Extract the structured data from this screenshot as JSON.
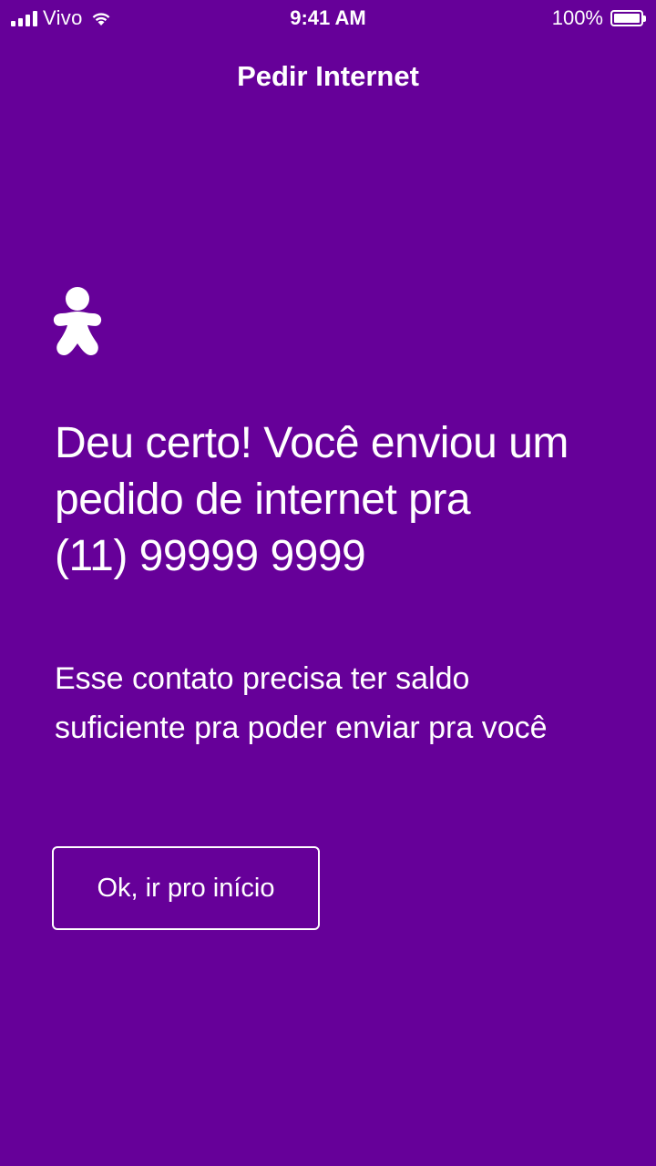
{
  "status_bar": {
    "carrier": "Vivo",
    "time": "9:41 AM",
    "battery": "100%",
    "signal_icon": "signal-bars-icon",
    "wifi_icon": "wifi-icon",
    "battery_icon": "battery-full-icon"
  },
  "nav": {
    "title": "Pedir Internet"
  },
  "main": {
    "logo_icon": "vivo-person-logo-icon",
    "headline_line1": "Deu certo!  Você enviou um",
    "headline_line2": "pedido de internet pra",
    "headline_line3": "(11) 99999 9999",
    "subtext_line1": "Esse contato precisa ter saldo",
    "subtext_line2": "suficiente pra poder enviar pra você",
    "ok_button_label": "Ok, ir pro início"
  },
  "colors": {
    "background": "#660099",
    "foreground": "#ffffff"
  }
}
